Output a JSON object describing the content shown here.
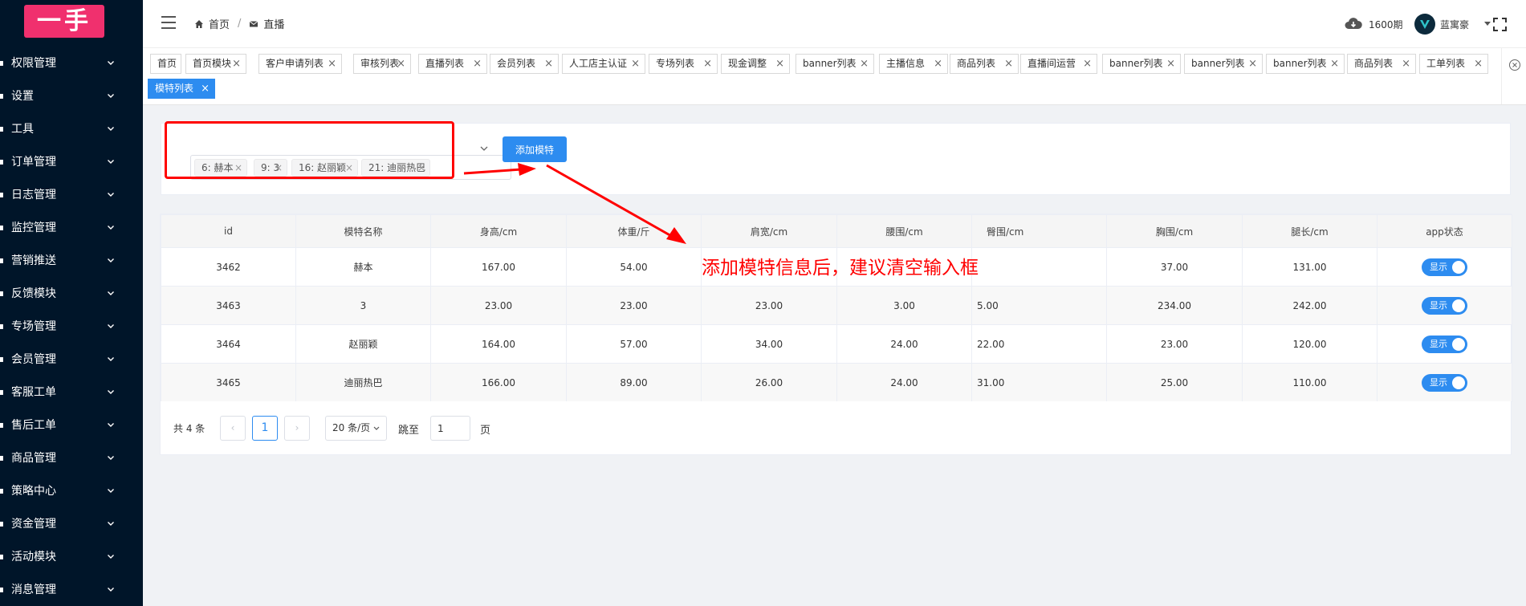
{
  "app": {
    "logo_text": "一手"
  },
  "sidebar": {
    "items": [
      {
        "label": "权限管理",
        "icon": "lock-icon"
      },
      {
        "label": "设置",
        "icon": "gear-icon"
      },
      {
        "label": "工具",
        "icon": "wrench-icon"
      },
      {
        "label": "订单管理",
        "icon": "order-icon"
      },
      {
        "label": "日志管理",
        "icon": "log-icon"
      },
      {
        "label": "监控管理",
        "icon": "monitor-icon"
      },
      {
        "label": "营销推送",
        "icon": "push-icon"
      },
      {
        "label": "反馈模块",
        "icon": "feedback-icon"
      },
      {
        "label": "专场管理",
        "icon": "venue-icon"
      },
      {
        "label": "会员管理",
        "icon": "member-icon"
      },
      {
        "label": "客服工单",
        "icon": "service-icon"
      },
      {
        "label": "售后工单",
        "icon": "aftersale-icon"
      },
      {
        "label": "商品管理",
        "icon": "goods-icon"
      },
      {
        "label": "策略中心",
        "icon": "strategy-icon"
      },
      {
        "label": "资金管理",
        "icon": "funds-icon"
      },
      {
        "label": "活动模块",
        "icon": "activity-icon"
      },
      {
        "label": "消息管理",
        "icon": "message-icon"
      }
    ]
  },
  "header": {
    "breadcrumb": [
      {
        "label": "首页",
        "icon": "home-icon"
      },
      {
        "label": "直播",
        "icon": "mail-icon"
      }
    ],
    "issue_label": "1600期",
    "username": "蓝寓豪"
  },
  "tabs": [
    {
      "label": "首页",
      "closable": false
    },
    {
      "label": "首页模块",
      "closable": true
    },
    {
      "label": "客户申请列表",
      "closable": true
    },
    {
      "label": "审核列表",
      "closable": true
    },
    {
      "label": "直播列表",
      "closable": true
    },
    {
      "label": "会员列表",
      "closable": true
    },
    {
      "label": "人工店主认证",
      "closable": true
    },
    {
      "label": "专场列表",
      "closable": true
    },
    {
      "label": "现金调整",
      "closable": true
    },
    {
      "label": "banner列表",
      "closable": true
    },
    {
      "label": "主播信息",
      "closable": true
    },
    {
      "label": "商品列表",
      "closable": true
    },
    {
      "label": "直播间运营",
      "closable": true
    },
    {
      "label": "banner列表",
      "closable": true
    },
    {
      "label": "banner列表",
      "closable": true
    },
    {
      "label": "banner列表",
      "closable": true
    },
    {
      "label": "商品列表",
      "closable": true
    },
    {
      "label": "工单列表",
      "closable": true
    },
    {
      "label": "模特列表",
      "closable": true,
      "active": true
    }
  ],
  "model_select": {
    "chips": [
      "6: 赫本",
      "9: 3",
      "16: 赵丽颖",
      "21: 迪丽热巴"
    ]
  },
  "add_button_label": "添加模特",
  "annotation": {
    "text": "添加模特信息后，建议清空输入框",
    "color": "#ff0000"
  },
  "table": {
    "columns": [
      "id",
      "模特名称",
      "身高/cm",
      "体重/斤",
      "肩宽/cm",
      "腰围/cm",
      "臀围/cm",
      "胸围/cm",
      "腿长/cm",
      "app状态"
    ],
    "rows": [
      [
        "3462",
        "赫本",
        "167.00",
        "54.00",
        "",
        "",
        "",
        "37.00",
        "131.00",
        "显示"
      ],
      [
        "3463",
        "3",
        "23.00",
        "23.00",
        "23.00",
        "3.00",
        "5.00",
        "234.00",
        "242.00",
        "显示"
      ],
      [
        "3464",
        "赵丽颖",
        "164.00",
        "57.00",
        "34.00",
        "24.00",
        "22.00",
        "23.00",
        "120.00",
        "显示"
      ],
      [
        "3465",
        "迪丽热巴",
        "166.00",
        "89.00",
        "26.00",
        "24.00",
        "31.00",
        "25.00",
        "110.00",
        "显示"
      ]
    ]
  },
  "pagination": {
    "total_text": "共 4 条",
    "current_page": "1",
    "page_size": "20 条/页",
    "jump_label": "跳至",
    "jump_value": "1",
    "jump_unit": "页"
  },
  "colors": {
    "sidebar_bg": "#001529",
    "logo_bg": "#f0306e",
    "primary": "#2d8cf0",
    "annotation_red": "#ff0000"
  }
}
